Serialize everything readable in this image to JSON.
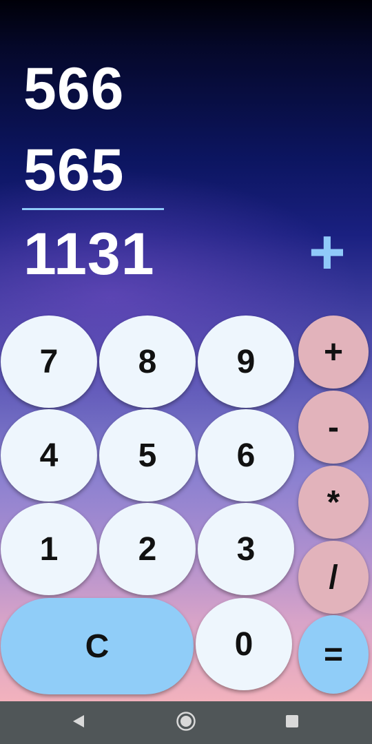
{
  "display": {
    "operand1": "566",
    "operand2": "565",
    "result": "1131",
    "operator": "+"
  },
  "keypad": {
    "k7": "7",
    "k8": "8",
    "k9": "9",
    "k4": "4",
    "k5": "5",
    "k6": "6",
    "k1": "1",
    "k2": "2",
    "k3": "3",
    "clear": "C",
    "k0": "0",
    "plus": "+",
    "minus": "-",
    "multiply": "*",
    "divide": "/",
    "equals": "="
  },
  "nav": {
    "back": "back-icon",
    "home": "home-icon",
    "recents": "recents-icon"
  },
  "colors": {
    "digit_key": "#eef6fd",
    "operator_key": "#e2b3bb",
    "accent_key": "#90cdf8",
    "indicator": "#90caf9"
  }
}
